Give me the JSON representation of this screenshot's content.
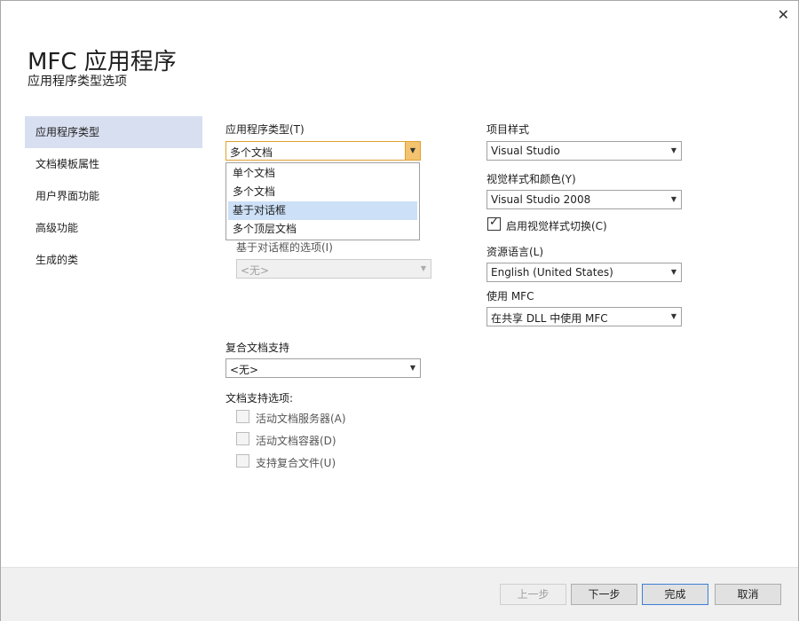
{
  "window": {
    "close_glyph": "✕"
  },
  "header": {
    "title": "MFC 应用程序",
    "subtitle": "应用程序类型选项"
  },
  "nav": {
    "items": [
      {
        "label": "应用程序类型",
        "active": true
      },
      {
        "label": "文档模板属性"
      },
      {
        "label": "用户界面功能"
      },
      {
        "label": "高级功能"
      },
      {
        "label": "生成的类"
      }
    ]
  },
  "app_type": {
    "label": "应用程序类型(T)",
    "value": "多个文档",
    "options": [
      "单个文档",
      "多个文档",
      "基于对话框",
      "多个顶层文档"
    ],
    "highlighted_index": 2
  },
  "dialog_options": {
    "label": "基于对话框的选项(I)",
    "value": "<无>"
  },
  "compound_doc": {
    "label": "复合文档支持",
    "value": "<无>"
  },
  "doc_support": {
    "label": "文档支持选项:",
    "options": [
      {
        "label": "活动文档服务器(A)",
        "checked": false
      },
      {
        "label": "活动文档容器(D)",
        "checked": false
      },
      {
        "label": "支持复合文件(U)",
        "checked": false
      }
    ]
  },
  "project_style": {
    "label": "项目样式",
    "value": "Visual Studio"
  },
  "visual_style": {
    "label": "视觉样式和颜色(Y)",
    "value": "Visual Studio 2008"
  },
  "enable_visual_switch": {
    "label": "启用视觉样式切换(C)",
    "checked": true
  },
  "resource_language": {
    "label": "资源语言(L)",
    "value": "English (United States)"
  },
  "use_mfc": {
    "label": "使用 MFC",
    "value": "在共享 DLL 中使用 MFC"
  },
  "footer": {
    "prev": "上一步",
    "next": "下一步",
    "finish": "完成",
    "cancel": "取消"
  }
}
